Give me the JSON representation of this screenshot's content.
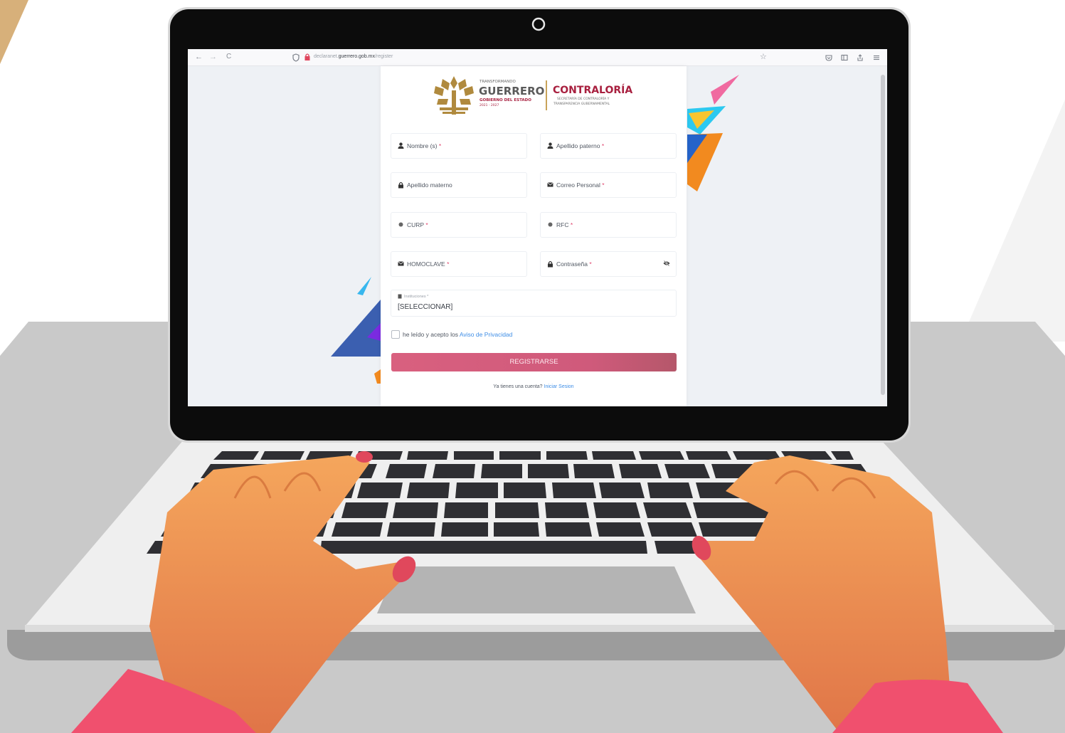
{
  "browser": {
    "nav_back": "←",
    "nav_forward": "→",
    "reload": "C",
    "url_prefix": "declaranet.",
    "url_domain": "guerrero.gob.mx",
    "url_path": "/register",
    "star_icon": "☆",
    "right_icons": [
      "shield-icon",
      "sidebar-icon",
      "share-icon",
      "menu-icon"
    ]
  },
  "logo": {
    "tagline": "TRANSFORMANDO",
    "state": "GUERRERO",
    "government": "GOBIERNO DEL ESTADO",
    "period": "2021 - 2027",
    "agency": "CONTRALORÍA",
    "agency_sub_1": "SECRETARÍA DE CONTRALORÍA Y",
    "agency_sub_2": "TRANSPARENCIA GUBERNAMENTAL"
  },
  "form": {
    "required_mark": "*",
    "fields": [
      {
        "label": "Nombre (s)",
        "icon": "user-icon",
        "required": true
      },
      {
        "label": "Apellido paterno",
        "icon": "user-icon",
        "required": true
      },
      {
        "label": "Apellido materno",
        "icon": "lock-icon",
        "required": false
      },
      {
        "label": "Correo Personal",
        "icon": "envelope-icon",
        "required": true
      },
      {
        "label": "CURP",
        "icon": "globe-icon",
        "required": true
      },
      {
        "label": "RFC",
        "icon": "globe-icon",
        "required": true
      },
      {
        "label": "HOMOCLAVE",
        "icon": "envelope-icon",
        "required": true
      },
      {
        "label": "Contraseña",
        "icon": "lock-icon",
        "required": true
      }
    ],
    "institutions_label": "Instituciones *",
    "institutions_value": "[SELECCIONAR]",
    "privacy_text": "he leído y acepto los",
    "privacy_link": "Aviso de Privacidad",
    "submit_label": "REGISTRARSE",
    "login_question": "Ya tienes una cuenta?",
    "login_link": "Iniciar Sesion"
  },
  "colors": {
    "accent": "#d9607f",
    "link": "#3f8ee6",
    "agency_red": "#a8203f",
    "gold": "#b08a3e",
    "hand": "#f2a25a",
    "sleeve": "#f0506e"
  }
}
